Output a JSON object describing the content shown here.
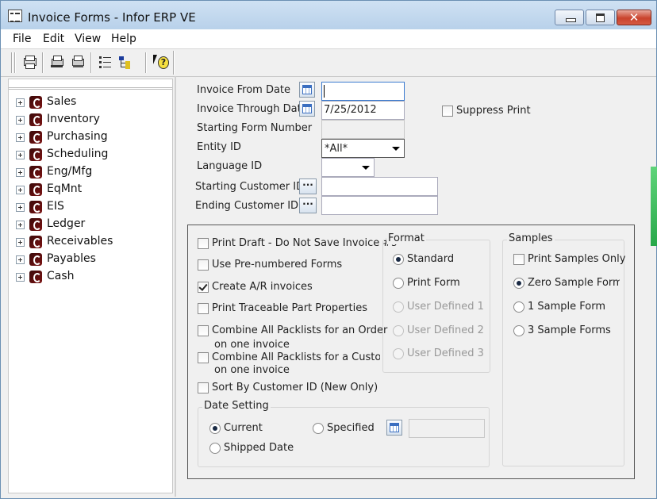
{
  "window": {
    "title": "Invoice Forms - Infor ERP VE"
  },
  "menu": [
    "File",
    "Edit",
    "View",
    "Help"
  ],
  "toolbar_icons": [
    "print-icon",
    "print-preview-icon",
    "print-setup-icon",
    "list-icon",
    "tree-icon",
    "help-icon"
  ],
  "tree": [
    {
      "label": "Sales"
    },
    {
      "label": "Inventory"
    },
    {
      "label": "Purchasing"
    },
    {
      "label": "Scheduling"
    },
    {
      "label": "Eng/Mfg"
    },
    {
      "label": "EqMnt"
    },
    {
      "label": "EIS"
    },
    {
      "label": "Ledger"
    },
    {
      "label": "Receivables"
    },
    {
      "label": "Payables"
    },
    {
      "label": "Cash"
    }
  ],
  "form": {
    "invoice_from_date": {
      "label": "Invoice From Date",
      "value": ""
    },
    "invoice_through_date": {
      "label": "Invoice Through Date",
      "value": "7/25/2012"
    },
    "suppress_print": {
      "label": "Suppress Print",
      "checked": false
    },
    "starting_form_number": {
      "label": "Starting Form Number",
      "value": ""
    },
    "entity_id": {
      "label": "Entity ID",
      "value": "*All*"
    },
    "language_id": {
      "label": "Language ID",
      "value": ""
    },
    "starting_customer_id": {
      "label": "Starting Customer ID",
      "value": ""
    },
    "ending_customer_id": {
      "label": "Ending Customer ID",
      "value": ""
    }
  },
  "options": [
    {
      "label": "Print Draft - Do Not Save Invoice #s",
      "checked": false
    },
    {
      "label": "Use Pre-numbered Forms",
      "checked": false
    },
    {
      "label": "Create A/R invoices",
      "checked": true
    },
    {
      "label": "Print Traceable Part Properties",
      "checked": false
    },
    {
      "label": "Combine All Packlists for an Order",
      "label2": "on one invoice",
      "checked": false
    },
    {
      "label": "Combine All Packlists for a Customer",
      "label2": "on one invoice",
      "checked": false
    },
    {
      "label": "Sort By Customer ID (New Only)",
      "checked": false
    }
  ],
  "format": {
    "title": "Format",
    "options": [
      {
        "label": "Standard",
        "selected": true,
        "enabled": true
      },
      {
        "label": "Print Form",
        "selected": false,
        "enabled": true
      },
      {
        "label": "User Defined 1",
        "selected": false,
        "enabled": false
      },
      {
        "label": "User Defined 2",
        "selected": false,
        "enabled": false
      },
      {
        "label": "User Defined 3",
        "selected": false,
        "enabled": false
      }
    ]
  },
  "samples": {
    "title": "Samples",
    "print_samples_only": {
      "label": "Print Samples Only",
      "checked": false
    },
    "options": [
      {
        "label": "Zero Sample Forms",
        "selected": true
      },
      {
        "label": "1 Sample Form",
        "selected": false
      },
      {
        "label": "3 Sample Forms",
        "selected": false
      }
    ]
  },
  "date_setting": {
    "title": "Date Setting",
    "current": {
      "label": "Current",
      "selected": true
    },
    "specified": {
      "label": "Specified",
      "selected": false
    },
    "shipped_date": {
      "label": "Shipped Date",
      "selected": false
    },
    "specified_value": ""
  }
}
